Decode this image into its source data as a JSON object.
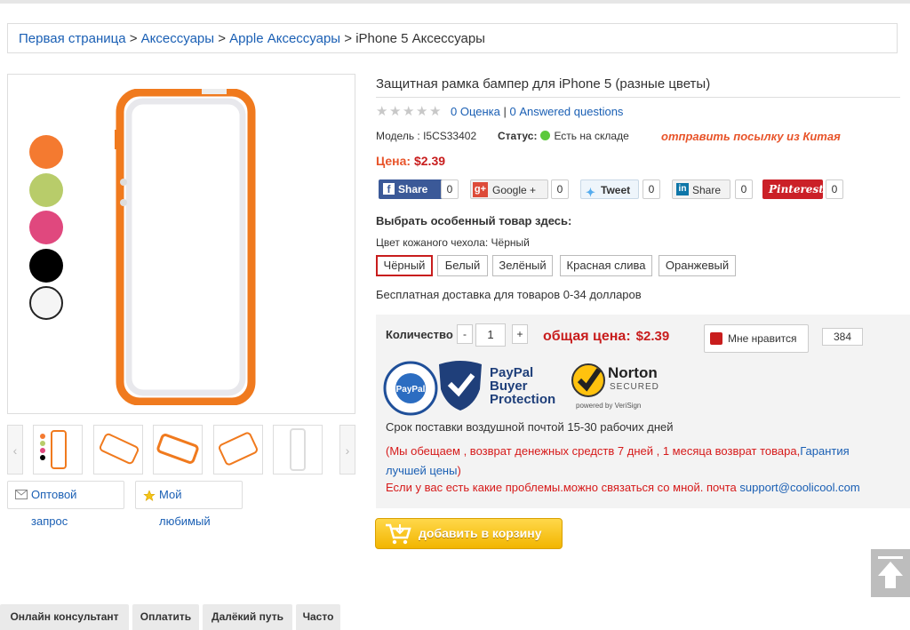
{
  "breadcrumb": {
    "items": [
      "Первая страница",
      "Аксессуары",
      "Apple Аксессуары"
    ],
    "current": "iPhone 5 Аксессуары",
    "sep": ">"
  },
  "gallery": {
    "swatches": [
      "#f47a30",
      "#b8cc6a",
      "#e0487e",
      "#000000",
      "#f5f5f5"
    ],
    "prev_icon": "‹",
    "next_icon": "›"
  },
  "actions": {
    "wholesale": "Оптовой запрос",
    "favorite": "Мой любимый"
  },
  "product": {
    "title": "Защитная рамка бампер для iPhone 5 (разные цветы)",
    "rating_link": "0 Оценка",
    "rating_sep": "|",
    "questions_link": "0 Answered questions",
    "model": "Модель : I5CS33402",
    "status_label": "Статус:",
    "status_value": "Есть на складе",
    "ship_note": "отправить посылку из Китая",
    "price_label": "Цена:",
    "price_value": "$2.39"
  },
  "share": {
    "facebook": {
      "label": "Share",
      "count": "0",
      "color": "#3b5998"
    },
    "google": {
      "label": "Google +",
      "count": "0",
      "color": "#dd4b39"
    },
    "twitter": {
      "label": "Tweet",
      "count": "0",
      "color": "#55acee"
    },
    "linkedin": {
      "label": "Share",
      "count": "0",
      "color": "#0e76a8"
    },
    "pinterest": {
      "label": "Pinterest",
      "count": "0",
      "color": "#cb2027"
    }
  },
  "options": {
    "heading": "Выбрать особенный товар здесь:",
    "color_label": "Цвет кожаного чехола: Чёрный",
    "values": [
      "Чёрный",
      "Белый",
      "Зелёный",
      "Красная слива",
      "Оранжевый"
    ],
    "selected": "Чёрный"
  },
  "free_shipping": "Бесплатная доставка для товаров 0-34 долларов",
  "purchase": {
    "qty_label": "Количество",
    "minus": "-",
    "qty": "1",
    "plus": "+",
    "total_label": "общая цена:",
    "total_value": "$2.39",
    "like_label": "Мне нравится",
    "like_count": "384"
  },
  "badges": {
    "paypal_ring": "BUYER PROTECTION · SAFER SHOPPING",
    "paypal_inner": "PayPal",
    "paypal_text": [
      "PayPal",
      "Buyer",
      "Protection"
    ],
    "norton_title": "Norton",
    "norton_sub": "SECURED",
    "norton_powered": "powered by VeriSign"
  },
  "delivery": "Срок поставки воздушной почтой 15-30 рабочих дней",
  "promise": "(Мы обещаем , возврат денежных средств 7 дней , 1 месяца возврат товара,",
  "promise_link": "Гарантия лучшей цены",
  "promise_end": ")",
  "contact_text": "Если у вас есть какие проблемы.можно связаться со мной. почта",
  "contact_email": "support@coolicool.com",
  "cart_button": "добавить в корзину",
  "bottom_tabs": [
    "Онлайн консультант",
    "Оплатить",
    "Далёкий путь",
    "Часто"
  ],
  "colors": {
    "link": "#1a5fb4",
    "price": "#c81d1d",
    "accent": "#e8542a",
    "cart": "#f2b500"
  }
}
